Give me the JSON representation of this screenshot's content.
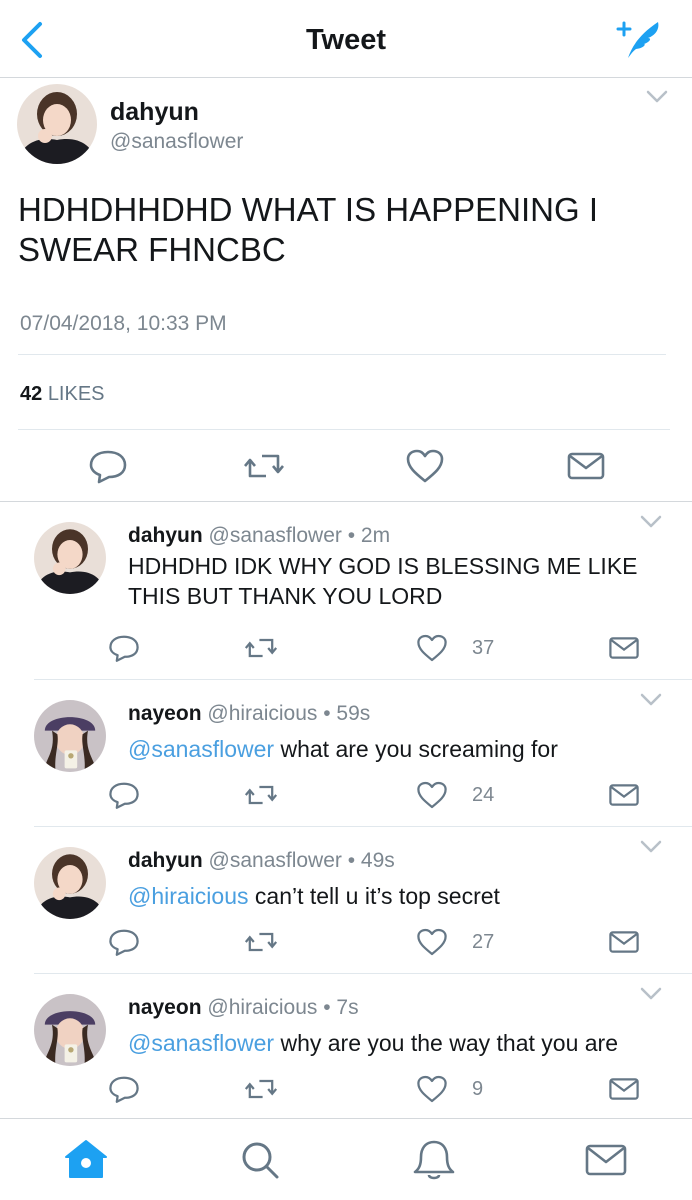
{
  "header": {
    "title": "Tweet",
    "back_icon": "chevron-left-icon",
    "compose_icon": "compose-tweet-icon"
  },
  "colors": {
    "accent": "#1da1f2",
    "mention": "#4a9fe0",
    "text": "#14171a",
    "secondary": "#7d8790"
  },
  "main_tweet": {
    "name": "dahyun",
    "handle": "@sanasflower",
    "text": "HDHDHHDHD WHAT IS HAPPENING I SWEAR FHNCBC",
    "timestamp": "07/04/2018, 10:33 PM",
    "likes_count": "42",
    "likes_label": "LIKES"
  },
  "replies": [
    {
      "name": "dahyun",
      "handle": "@sanasflower",
      "time": "• 2m",
      "mention": "",
      "text": "HDHDHD IDK WHY GOD IS BLESSING ME LIKE THIS BUT THANK YOU LORD",
      "likes": "37"
    },
    {
      "name": "nayeon",
      "handle": "@hiraicious",
      "time": "• 59s",
      "mention": "@sanasflower",
      "text": " what are you screaming for",
      "likes": "24"
    },
    {
      "name": "dahyun",
      "handle": "@sanasflower",
      "time": "• 49s",
      "mention": "@hiraicious",
      "text": " can’t tell u it’s top secret",
      "likes": "27"
    },
    {
      "name": "nayeon",
      "handle": "@hiraicious",
      "time": "• 7s",
      "mention": "@sanasflower",
      "text": " why are you the way that you are",
      "likes": "9"
    }
  ],
  "tabbar": {
    "items": [
      "home-icon",
      "search-icon",
      "notifications-icon",
      "messages-icon"
    ],
    "active": "home-icon"
  }
}
